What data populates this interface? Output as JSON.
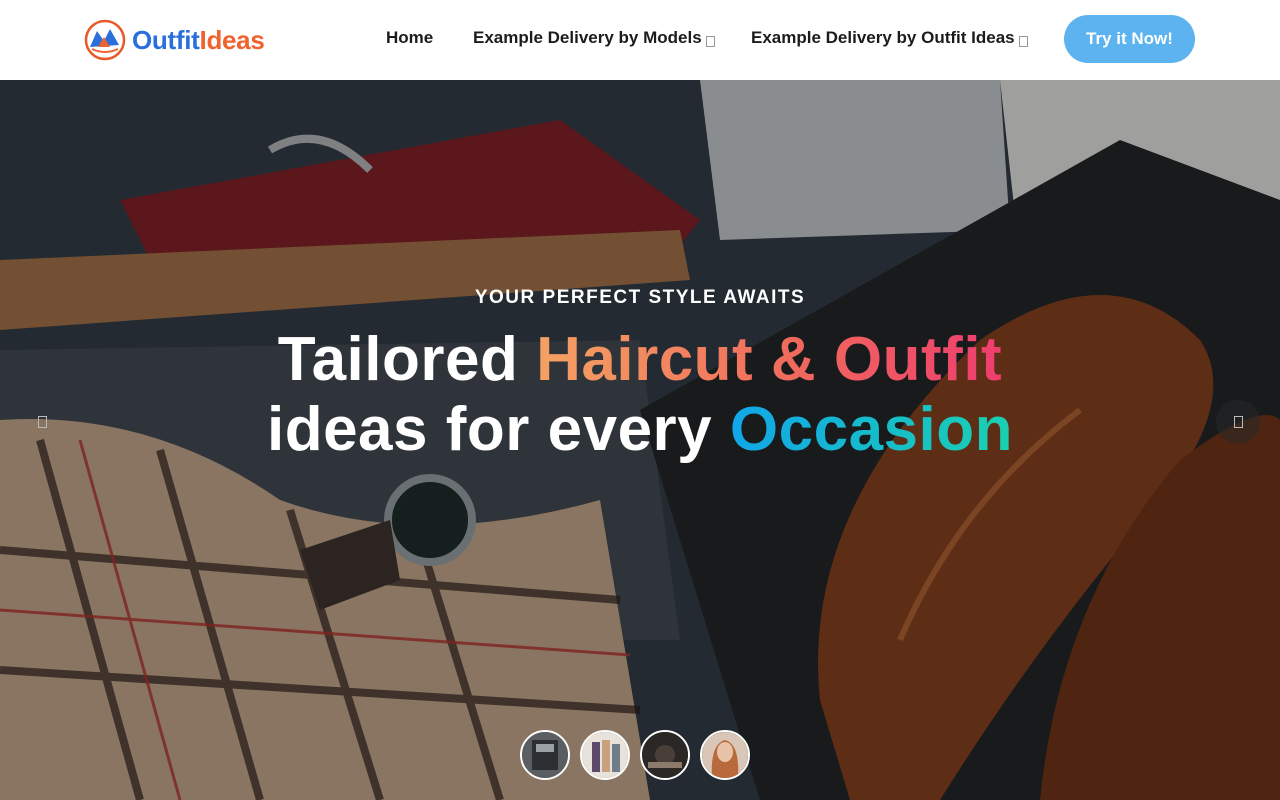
{
  "brand": {
    "part1": "Outfit",
    "part2": "Ideas"
  },
  "nav": {
    "home": "Home",
    "models": "Example Delivery by Models",
    "outfit": "Example Delivery by Outfit Ideas"
  },
  "cta": "Try it Now!",
  "hero": {
    "eyebrow": "YOUR PERFECT STYLE AWAITS",
    "line1_plain": "Tailored ",
    "line1_accent": "Haircut & Outfit",
    "line2_plain": "ideas for every ",
    "line2_accent": "Occasion"
  },
  "colors": {
    "brand_blue": "#2a6fdb",
    "brand_orange": "#f0632e",
    "cta": "#5cb3ef",
    "accent_warm_start": "#f4a263",
    "accent_warm_end": "#ee3d6f",
    "accent_cool_start": "#12a6e8",
    "accent_cool_end": "#1bd0b0"
  }
}
